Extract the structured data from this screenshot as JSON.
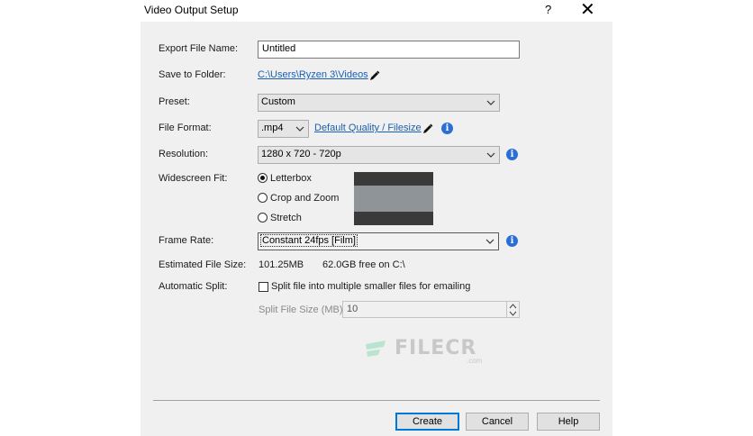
{
  "window": {
    "title": "Video Output Setup",
    "help_glyph": "?",
    "close_glyph": "✕"
  },
  "export_file_name": {
    "label": "Export File Name:",
    "value": "Untitled"
  },
  "save_to_folder": {
    "label": "Save to Folder:",
    "path": "C:\\Users\\Ryzen 3\\Videos",
    "edit_icon": "pencil-icon"
  },
  "preset": {
    "label": "Preset:",
    "value": "Custom"
  },
  "file_format": {
    "label": "File Format:",
    "value": ".mp4",
    "quality_link": "Default Quality / Filesize",
    "edit_icon": "pencil-icon",
    "info_icon": "info-icon"
  },
  "resolution": {
    "label": "Resolution:",
    "value": "1280 x 720 - 720p",
    "info_icon": "info-icon"
  },
  "widescreen_fit": {
    "label": "Widescreen Fit:",
    "options": [
      {
        "label": "Letterbox",
        "selected": true
      },
      {
        "label": "Crop and Zoom",
        "selected": false
      },
      {
        "label": "Stretch",
        "selected": false
      }
    ]
  },
  "frame_rate": {
    "label": "Frame Rate:",
    "value": "Constant 24fps [Film]",
    "info_icon": "info-icon"
  },
  "estimated_file_size": {
    "label": "Estimated File Size:",
    "size": "101.25MB",
    "free_space": "62.0GB free on C:\\"
  },
  "automatic_split": {
    "label": "Automatic Split:",
    "checkbox_label": "Split file into multiple smaller files for emailing",
    "checked": false
  },
  "split_file_size": {
    "label": "Split File Size (MB):",
    "value": "10",
    "disabled": true
  },
  "watermark": {
    "text": "FILECR",
    "sub": ".com"
  },
  "buttons": {
    "create": "Create",
    "cancel": "Cancel",
    "help": "Help"
  },
  "colors": {
    "link": "#1a5fb4",
    "info": "#2a6fd6",
    "dialog_bg": "#f0f0f0",
    "default_button_border": "#0078d7"
  }
}
